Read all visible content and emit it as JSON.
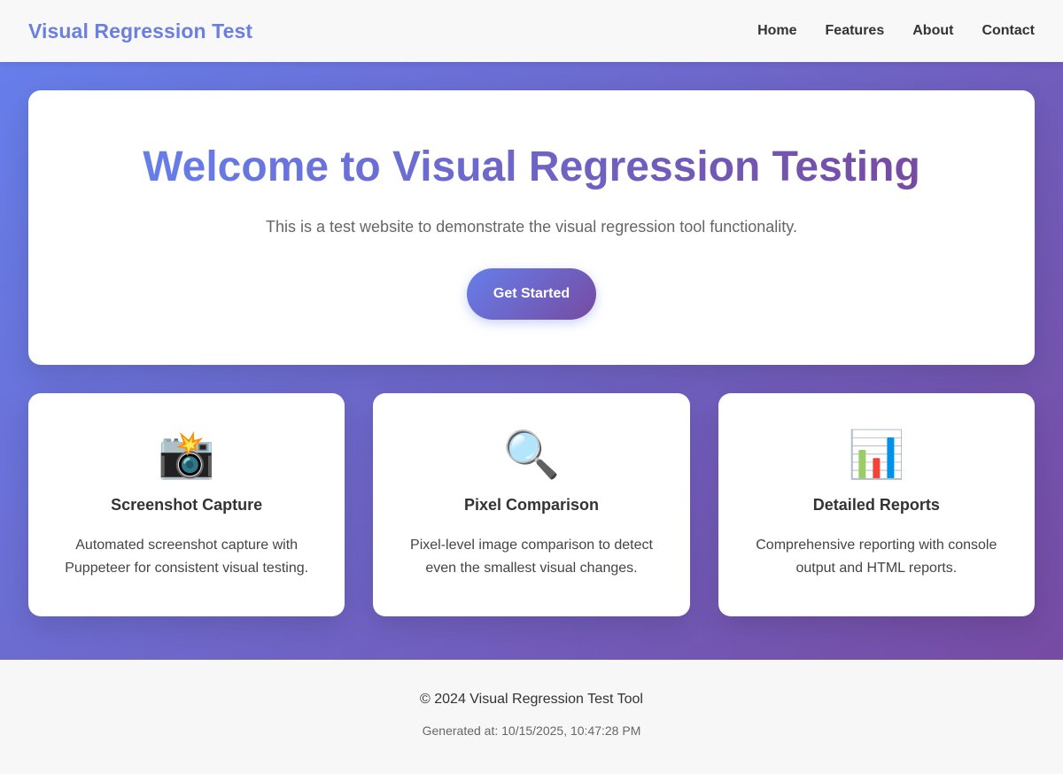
{
  "nav": {
    "brand": "Visual Regression Test",
    "links": [
      "Home",
      "Features",
      "About",
      "Contact"
    ]
  },
  "hero": {
    "title": "Welcome to Visual Regression Testing",
    "subtitle": "This is a test website to demonstrate the visual regression tool functionality.",
    "button_label": "Get Started"
  },
  "features": [
    {
      "icon": "📸",
      "icon_name": "camera-with-flash-icon",
      "title": "Screenshot Capture",
      "description": "Automated screenshot capture with Puppeteer for consistent visual testing."
    },
    {
      "icon": "🔍",
      "icon_name": "magnifying-glass-icon",
      "title": "Pixel Comparison",
      "description": "Pixel-level image comparison to detect even the smallest visual changes."
    },
    {
      "icon": "📊",
      "icon_name": "bar-chart-icon",
      "title": "Detailed Reports",
      "description": "Comprehensive reporting with console output and HTML reports."
    }
  ],
  "footer": {
    "copyright": "© 2024 Visual Regression Test Tool",
    "generated": "Generated at: 10/15/2025, 10:47:28 PM"
  },
  "colors": {
    "gradient_start": "#667eea",
    "gradient_end": "#764ba2",
    "brand": "#6a7fe0"
  }
}
